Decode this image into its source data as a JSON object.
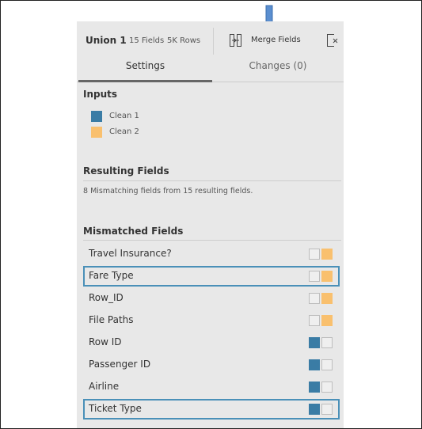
{
  "header": {
    "title": "Union 1",
    "fields": "15 Fields",
    "rows": "5K Rows",
    "merge_label": "Merge Fields",
    "merge_icon": "merge-fields-icon",
    "close_icon": "remove-field-icon"
  },
  "tabs": [
    {
      "label": "Settings",
      "active": true
    },
    {
      "label": "Changes (0)",
      "active": false
    }
  ],
  "inputs": {
    "title": "Inputs",
    "items": [
      {
        "label": "Clean 1",
        "color": "#3a7ca5"
      },
      {
        "label": "Clean 2",
        "color": "#f9c06e"
      }
    ]
  },
  "resulting": {
    "title": "Resulting Fields",
    "summary": "8 Mismatching fields from 15 resulting fields."
  },
  "mismatched": {
    "title": "Mismatched Fields",
    "fields": [
      {
        "label": "Travel Insurance?",
        "source": "Clean 2",
        "selected": false
      },
      {
        "label": "Fare Type",
        "source": "Clean 2",
        "selected": true
      },
      {
        "label": "Row_ID",
        "source": "Clean 2",
        "selected": false
      },
      {
        "label": "File Paths",
        "source": "Clean 2",
        "selected": false
      },
      {
        "label": "Row ID",
        "source": "Clean 1",
        "selected": false
      },
      {
        "label": "Passenger ID",
        "source": "Clean 1",
        "selected": false
      },
      {
        "label": "Airline",
        "source": "Clean 1",
        "selected": false
      },
      {
        "label": "Ticket Type",
        "source": "Clean 1",
        "selected": true
      }
    ]
  },
  "colors": {
    "clean1": "#3a7ca5",
    "clean2": "#f9c06e",
    "selection": "#4a90b8",
    "arrow": "#5b8fd0"
  }
}
